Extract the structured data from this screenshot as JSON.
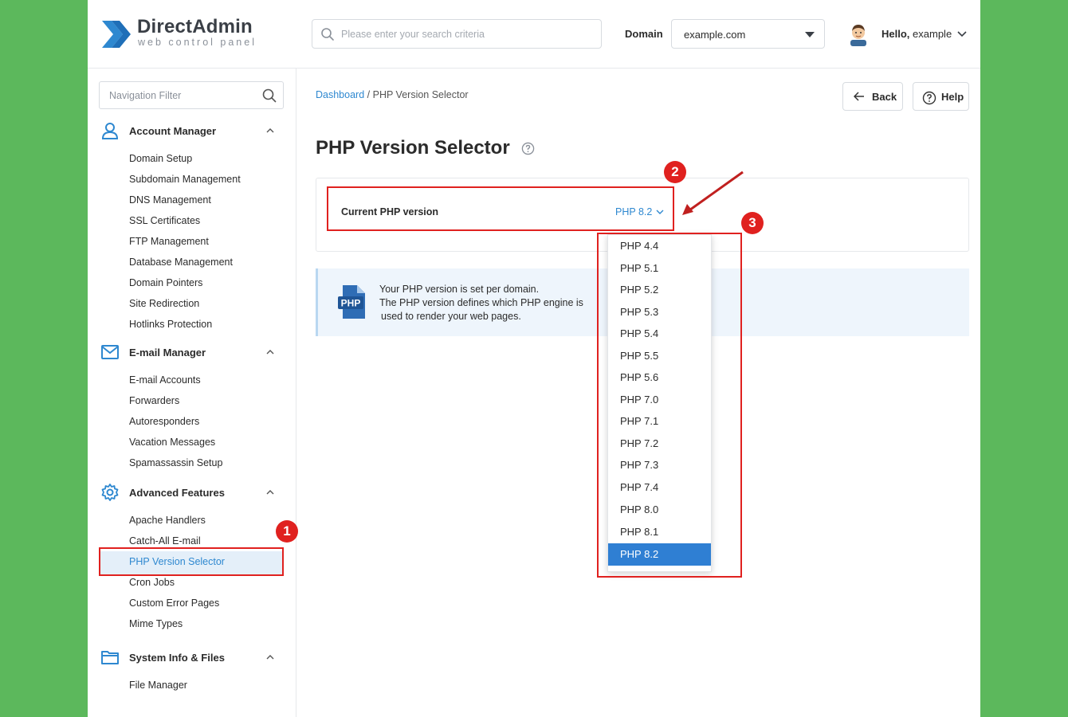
{
  "header": {
    "logo_name": "DirectAdmin",
    "logo_tagline": "web control panel",
    "search_placeholder": "Please enter your search criteria",
    "domain_label": "Domain",
    "domain_value": "example.com",
    "greeting": "Hello,",
    "username": "example"
  },
  "sidebar": {
    "filter_placeholder": "Navigation Filter",
    "sections": [
      {
        "title": "Account Manager",
        "icon": "user-icon",
        "items": [
          "Domain Setup",
          "Subdomain Management",
          "DNS Management",
          "SSL Certificates",
          "FTP Management",
          "Database Management",
          "Domain Pointers",
          "Site Redirection",
          "Hotlinks Protection"
        ]
      },
      {
        "title": "E-mail Manager",
        "icon": "envelope-icon",
        "items": [
          "E-mail Accounts",
          "Forwarders",
          "Autoresponders",
          "Vacation Messages",
          "Spamassassin Setup"
        ]
      },
      {
        "title": "Advanced Features",
        "icon": "gear-icon",
        "items": [
          "Apache Handlers",
          "Catch-All E-mail",
          "PHP Version Selector",
          "Cron Jobs",
          "Custom Error Pages",
          "Mime Types"
        ]
      },
      {
        "title": "System Info & Files",
        "icon": "folder-icon",
        "items": [
          "File Manager"
        ]
      }
    ],
    "active_item": "PHP Version Selector"
  },
  "main": {
    "breadcrumb": {
      "root": "Dashboard",
      "separator": "/",
      "current": "PHP Version Selector"
    },
    "back_label": "Back",
    "help_label": "Help",
    "title": "PHP Version Selector",
    "current_php_label": "Current PHP version",
    "current_php_value": "PHP 8.2",
    "info_badge": "PHP",
    "info_lines": [
      "Your PHP version is set per domain.",
      "The PHP version defines which PHP engine is",
      "used to render your web pages."
    ]
  },
  "dropdown": {
    "options": [
      "PHP 4.4",
      "PHP 5.1",
      "PHP 5.2",
      "PHP 5.3",
      "PHP 5.4",
      "PHP 5.5",
      "PHP 5.6",
      "PHP 7.0",
      "PHP 7.1",
      "PHP 7.2",
      "PHP 7.3",
      "PHP 7.4",
      "PHP 8.0",
      "PHP 8.1",
      "PHP 8.2"
    ],
    "selected": "PHP 8.2"
  },
  "annotations": {
    "step1": "1",
    "step2": "2",
    "step3": "3"
  },
  "colors": {
    "accent": "#2e88d0",
    "annotation": "#e0211f",
    "selected_bg": "#2f7fd3",
    "background": "#5cb85c"
  }
}
